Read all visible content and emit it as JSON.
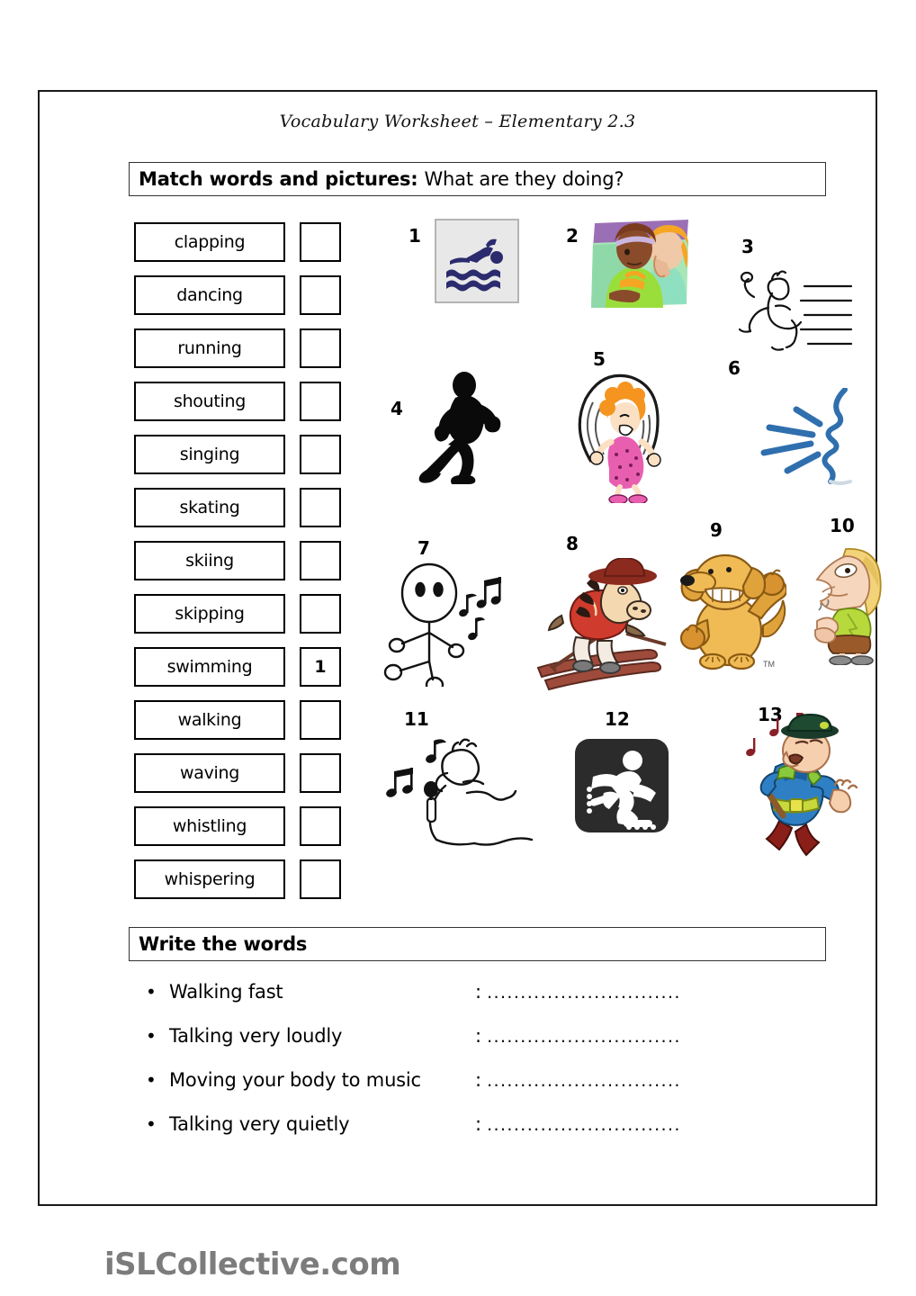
{
  "worksheet": {
    "title": "Vocabulary Worksheet – Elementary 2.3",
    "footer_logo": "iSLCollective.com"
  },
  "match_section": {
    "heading_strong": "Match words and pictures:",
    "heading_rest": "What are they doing?",
    "words": [
      {
        "label": "clapping",
        "answer": ""
      },
      {
        "label": "dancing",
        "answer": ""
      },
      {
        "label": "running",
        "answer": ""
      },
      {
        "label": "shouting",
        "answer": ""
      },
      {
        "label": "singing",
        "answer": ""
      },
      {
        "label": "skating",
        "answer": ""
      },
      {
        "label": "skiing",
        "answer": ""
      },
      {
        "label": "skipping",
        "answer": ""
      },
      {
        "label": "swimming",
        "answer": "1"
      },
      {
        "label": "walking",
        "answer": ""
      },
      {
        "label": "waving",
        "answer": ""
      },
      {
        "label": "whistling",
        "answer": ""
      },
      {
        "label": "whispering",
        "answer": ""
      }
    ],
    "pictures": [
      {
        "number": "1",
        "icon": "swimming-pictogram-icon",
        "depicts": "swimming"
      },
      {
        "number": "2",
        "icon": "two-people-whispering-icon",
        "depicts": "whispering"
      },
      {
        "number": "3",
        "icon": "running-person-lineart-icon",
        "depicts": "running"
      },
      {
        "number": "4",
        "icon": "walking-silhouette-icon",
        "depicts": "walking"
      },
      {
        "number": "5",
        "icon": "girl-skipping-rope-icon",
        "depicts": "skipping"
      },
      {
        "number": "6",
        "icon": "shouting-profile-icon",
        "depicts": "shouting"
      },
      {
        "number": "7",
        "icon": "dancing-stick-figure-icon",
        "depicts": "dancing"
      },
      {
        "number": "8",
        "icon": "skiing-horse-icon",
        "depicts": "skiing"
      },
      {
        "number": "9",
        "icon": "waving-dog-icon",
        "depicts": "waving"
      },
      {
        "number": "10",
        "icon": "clapping-woman-icon",
        "depicts": "clapping"
      },
      {
        "number": "11",
        "icon": "singing-microphone-icon",
        "depicts": "singing"
      },
      {
        "number": "12",
        "icon": "skating-pictogram-icon",
        "depicts": "skating"
      },
      {
        "number": "13",
        "icon": "whistling-policeman-icon",
        "depicts": "whistling"
      }
    ]
  },
  "write_section": {
    "heading": "Write the words",
    "dots": "..................................",
    "colon": ":",
    "bullet": "•",
    "items": [
      {
        "prompt": "Walking fast"
      },
      {
        "prompt": "Talking very loudly"
      },
      {
        "prompt": "Moving your body to music"
      },
      {
        "prompt": "Talking very quietly"
      }
    ]
  },
  "colors": {
    "ink": "#000000",
    "frame": "#1a1a1a",
    "logo_gray": "#7c7c7c",
    "swim_navy": "#2b2b6e",
    "swim_tile": "#e8e8e8",
    "skate_dark": "#2b2b2b"
  }
}
